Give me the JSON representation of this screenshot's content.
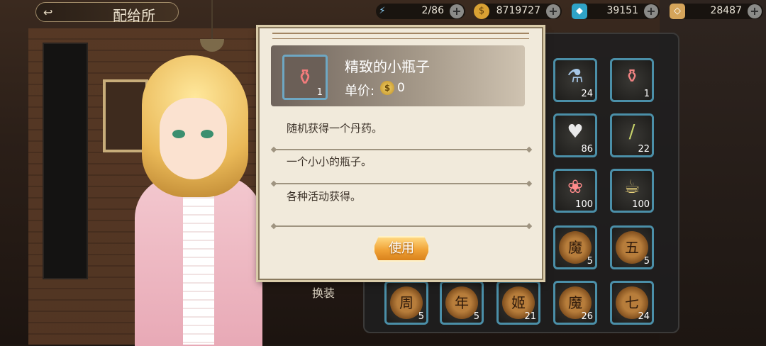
{
  "header": {
    "title": "配给所"
  },
  "resources": [
    {
      "name": "stamina",
      "icon": "lightning-icon",
      "value": "2/86"
    },
    {
      "name": "gold",
      "icon": "gold-coin-icon",
      "value": "8719727"
    },
    {
      "name": "crystal",
      "icon": "crystal-icon",
      "value": "39151"
    },
    {
      "name": "diamond",
      "icon": "gem-icon",
      "value": "28487"
    }
  ],
  "dialog": {
    "item_name": "精致的小瓶子",
    "item_count": "1",
    "price_label": "单价:",
    "price_value": "0",
    "description_1": "随机获得一个丹药。",
    "description_2": "一个小小的瓶子。",
    "description_3": "各种活动获得。",
    "use_label": "使用"
  },
  "change_label": "换装",
  "inventory": [
    {
      "icon": "potion-bottle-icon",
      "count": "24"
    },
    {
      "icon": "small-bottle-icon",
      "count": "1"
    },
    {
      "icon": "dice-card-icon",
      "count": "86"
    },
    {
      "icon": "thermometer-icon",
      "count": "22"
    },
    {
      "icon": "salad-dish-icon",
      "count": "100"
    },
    {
      "icon": "food-platter-icon",
      "count": "100"
    },
    {
      "icon": "coin-token-icon",
      "glyph": "魔",
      "count": "5"
    },
    {
      "icon": "coin-token-icon",
      "glyph": "五",
      "count": "5"
    },
    {
      "icon": "coin-token-icon",
      "glyph": "周",
      "count": "5"
    },
    {
      "icon": "coin-token-icon",
      "glyph": "年",
      "count": "5"
    },
    {
      "icon": "coin-token-icon",
      "glyph": "姬",
      "count": "21"
    },
    {
      "icon": "coin-token-icon",
      "glyph": "魔",
      "count": "26"
    },
    {
      "icon": "coin-token-icon",
      "glyph": "七",
      "count": "24"
    }
  ],
  "colors": {
    "dialog_bg": "#f1eadb",
    "slot_border": "#4b8fa8",
    "button_orange": "#f0a236"
  }
}
